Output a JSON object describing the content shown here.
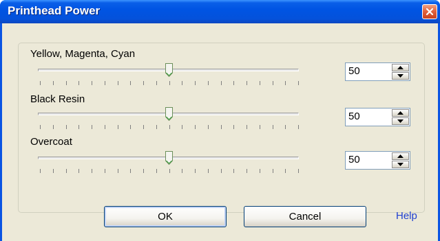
{
  "window": {
    "title": "Printhead Power"
  },
  "sliders": [
    {
      "label": "Yellow, Magenta, Cyan",
      "value": "50",
      "level_percent": 50
    },
    {
      "label": "Black Resin",
      "value": "50",
      "level_percent": 50
    },
    {
      "label": "Overcoat",
      "value": "50",
      "level_percent": 50
    }
  ],
  "buttons": {
    "ok": "OK",
    "cancel": "Cancel",
    "help": "Help"
  },
  "colors": {
    "titlebar": "#0054e3",
    "dialog_bg": "#ece9d8",
    "link": "#1f3fd0",
    "close": "#e3643f"
  }
}
